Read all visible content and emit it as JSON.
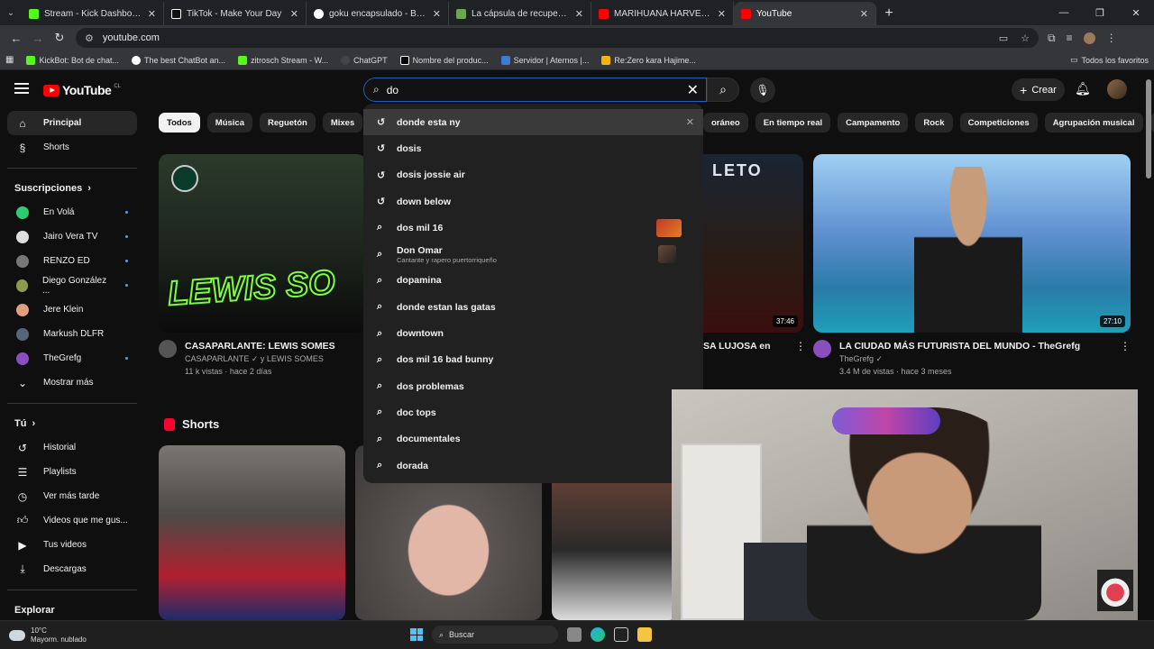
{
  "browser": {
    "tabs": [
      {
        "title": "Stream - Kick Dashboard",
        "color": "#53fc18"
      },
      {
        "title": "TikTok - Make Your Day",
        "color": "#111111"
      },
      {
        "title": "goku encapsulado - Buscar con",
        "color": "#4285f4"
      },
      {
        "title": "La cápsula de recuperación de",
        "color": "#6aa84f"
      },
      {
        "title": "MARIHUANA HARVEST DAY: Th",
        "color": "#ff0000"
      },
      {
        "title": "YouTube",
        "color": "#ff0000"
      }
    ],
    "url": "youtube.com",
    "bookmarks": [
      "KickBot: Bot de chat...",
      "The best ChatBot an...",
      "zitrosch Stream - W...",
      "ChatGPT",
      "Nombre del produc...",
      "Servidor | Aternos |...",
      "Re:Zero kara Hajime..."
    ],
    "all_bookmarks": "Todos los favoritos"
  },
  "yt": {
    "logo": "YouTube",
    "country": "CL",
    "search_value": "do",
    "create_label": "Crear",
    "sidebar": {
      "main": [
        {
          "label": "Principal"
        },
        {
          "label": "Shorts"
        }
      ],
      "subs_header": "Suscripciones",
      "subs": [
        {
          "label": "En Volá",
          "color": "#2ecc71"
        },
        {
          "label": "Jairo Vera TV",
          "color": "#dddddd"
        },
        {
          "label": "RENZO ED",
          "color": "#777777"
        },
        {
          "label": "Diego González ...",
          "color": "#8d9b4a"
        },
        {
          "label": "Jere Klein",
          "color": "#e0a080"
        },
        {
          "label": "Markush DLFR",
          "color": "#556677"
        },
        {
          "label": "TheGrefg",
          "color": "#8a4fbf"
        }
      ],
      "more": "Mostrar más",
      "you_header": "Tú",
      "you": [
        {
          "label": "Historial"
        },
        {
          "label": "Playlists"
        },
        {
          "label": "Ver más tarde"
        },
        {
          "label": "Videos que me gus..."
        },
        {
          "label": "Tus videos"
        },
        {
          "label": "Descargas"
        }
      ],
      "explore_header": "Explorar"
    },
    "chips": [
      "Todos",
      "Música",
      "Reguetón",
      "Mixes"
    ],
    "chips_right": [
      "oráneo",
      "En tiempo real",
      "Campamento",
      "Rock",
      "Competiciones",
      "Agrupación musical",
      "T"
    ],
    "videos": [
      {
        "title": "CASAPARLANTE: LEWIS SOMES",
        "channel": "CASAPARLANTE ✓ y LEWIS SOMES",
        "stats": "11 k vistas · hace 2 días"
      },
      {
        "title": "SA LUJOSA en",
        "duration": "37:46"
      },
      {
        "title": "LA CIUDAD MÁS FUTURISTA DEL MUNDO - TheGrefg",
        "channel": "TheGrefg ✓",
        "stats": "3.4 M de vistas · hace 3 meses",
        "duration": "27:10"
      }
    ],
    "shorts_label": "Shorts",
    "thumb_text": "LEWIS SO",
    "thumb_text2": "LETO",
    "suggestions": [
      {
        "text": "donde esta ny",
        "history": true
      },
      {
        "text": "dosis",
        "history": true
      },
      {
        "text": "dosis jossie air",
        "history": true
      },
      {
        "text": "down below",
        "history": true
      },
      {
        "text": "dos mil 16"
      },
      {
        "text": "Don Omar",
        "sub": "Cantante y rapero puertorriqueño"
      },
      {
        "text": "dopamina"
      },
      {
        "text": "donde estan las gatas"
      },
      {
        "text": "downtown"
      },
      {
        "text": "dos mil 16 bad bunny"
      },
      {
        "text": "dos problemas"
      },
      {
        "text": "doc tops"
      },
      {
        "text": "documentales"
      },
      {
        "text": "dorada"
      }
    ]
  },
  "taskbar": {
    "temp": "10°C",
    "weather": "Mayorm. nublado",
    "search": "Buscar"
  }
}
